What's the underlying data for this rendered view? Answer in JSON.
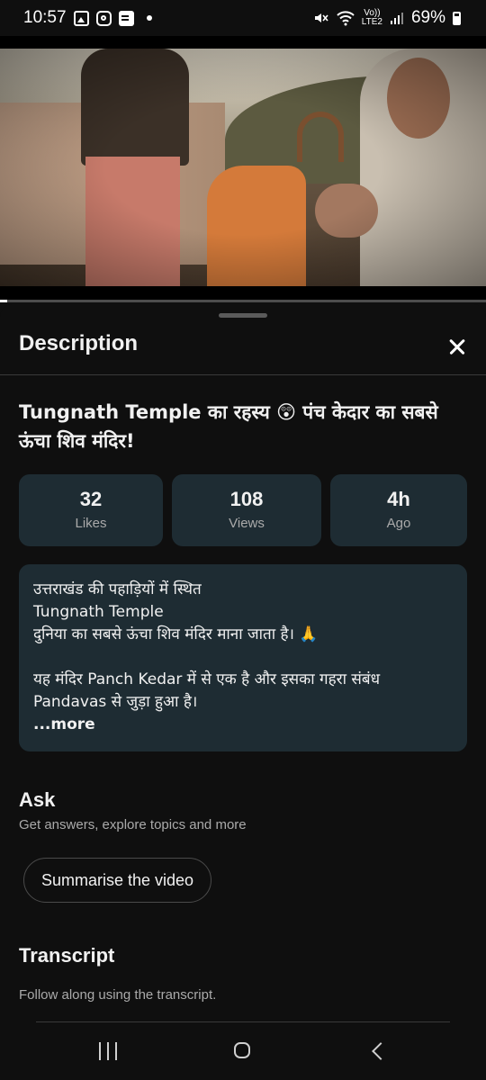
{
  "status_bar": {
    "time": "10:57",
    "battery_text": "69%",
    "network_label_top": "Vo))",
    "network_label_bottom": "LTE2",
    "battery_level": 0.69
  },
  "video": {
    "progress_fraction": 0.015
  },
  "sheet": {
    "title": "Description",
    "video_title": "Tungnath Temple का रहस्य 😲 पंच केदार का सबसे ऊंचा शिव मंदिर!",
    "stats": [
      {
        "value": "32",
        "label": "Likes"
      },
      {
        "value": "108",
        "label": "Views"
      },
      {
        "value": "4h",
        "label": "Ago"
      }
    ],
    "description_lines": [
      "उत्तराखंड की पहाड़ियों में स्थित",
      "Tungnath Temple",
      "दुनिया का सबसे ऊंचा शिव मंदिर माना जाता है। 🙏",
      "",
      "यह मंदिर Panch Kedar में से एक है और इसका गहरा संबंध",
      "Pandavas से जुड़ा हुआ है।"
    ],
    "more_label": "...more",
    "ask": {
      "title": "Ask",
      "subtitle": "Get answers, explore topics and more",
      "button_label": "Summarise the video"
    },
    "transcript": {
      "title": "Transcript",
      "subtitle": "Follow along using the transcript."
    }
  },
  "icons": {
    "status_left": [
      "gallery-icon",
      "instagram-icon",
      "news-icon",
      "notification-dot-icon"
    ],
    "status_right": [
      "mute-icon",
      "wifi-icon",
      "signal-icon",
      "battery-icon"
    ],
    "nav": [
      "recents-icon",
      "home-icon",
      "back-icon"
    ]
  }
}
